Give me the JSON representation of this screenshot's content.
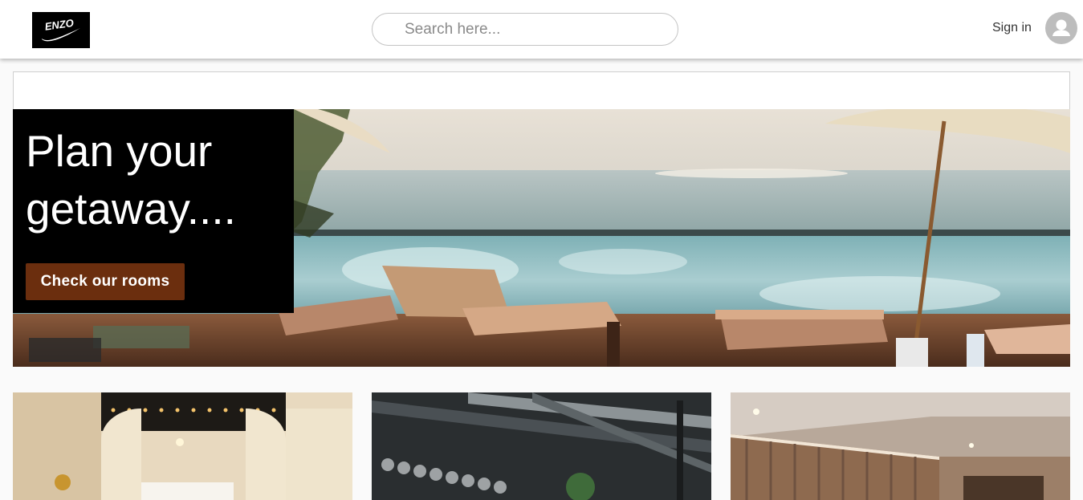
{
  "header": {
    "logo_text": "ENZO",
    "search": {
      "placeholder": "Search here...",
      "value": ""
    },
    "signin_label": "Sign in"
  },
  "hero": {
    "title": "Plan your getaway....",
    "cta_label": "Check our rooms"
  },
  "colors": {
    "accent": "#6b2e0e",
    "header_bg": "#ffffff",
    "hero_box_bg": "#000000"
  },
  "cards": [
    {
      "icon": "lobby-photo"
    },
    {
      "icon": "restaurant-photo"
    },
    {
      "icon": "room-photo"
    }
  ]
}
